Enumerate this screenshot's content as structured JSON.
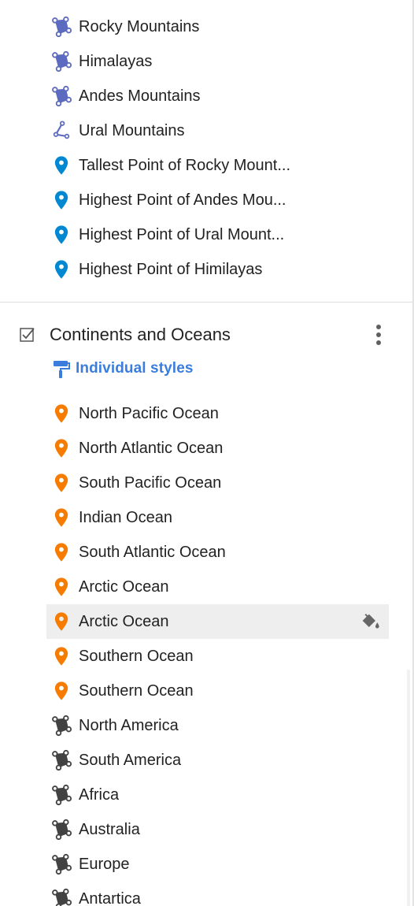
{
  "top_items": [
    {
      "label": "Rocky Mountains",
      "icon": "polygon-icon",
      "color": "#5c6bc0"
    },
    {
      "label": "Himalayas",
      "icon": "polygon-icon",
      "color": "#5c6bc0"
    },
    {
      "label": "Andes Mountains",
      "icon": "polygon-icon",
      "color": "#5c6bc0"
    },
    {
      "label": "Ural Mountains",
      "icon": "line-icon",
      "color": "#5c6bc0"
    },
    {
      "label": "Tallest Point of Rocky Mount...",
      "icon": "pin-icon",
      "color": "#0288d1"
    },
    {
      "label": "Highest Point of Andes Mou...",
      "icon": "pin-icon",
      "color": "#0288d1"
    },
    {
      "label": "Highest Point of Ural Mount...",
      "icon": "pin-icon",
      "color": "#0288d1"
    },
    {
      "label": "Highest Point of Himilayas",
      "icon": "pin-icon",
      "color": "#0288d1"
    }
  ],
  "layer": {
    "title": "Continents and Oceans",
    "checked": true,
    "styles_label": "Individual styles",
    "styles_color": "#3b7ddd"
  },
  "layer_items": [
    {
      "label": "North Pacific Ocean",
      "icon": "pin-icon",
      "color": "#f57c00"
    },
    {
      "label": "North Atlantic Ocean",
      "icon": "pin-icon",
      "color": "#f57c00"
    },
    {
      "label": "South Pacific Ocean",
      "icon": "pin-icon",
      "color": "#f57c00"
    },
    {
      "label": "Indian Ocean",
      "icon": "pin-icon",
      "color": "#f57c00"
    },
    {
      "label": "South Atlantic Ocean",
      "icon": "pin-icon",
      "color": "#f57c00"
    },
    {
      "label": "Arctic Ocean",
      "icon": "pin-icon",
      "color": "#f57c00"
    },
    {
      "label": "Arctic Ocean",
      "icon": "pin-icon",
      "color": "#f57c00",
      "highlighted": true
    },
    {
      "label": "Southern Ocean",
      "icon": "pin-icon",
      "color": "#f57c00"
    },
    {
      "label": "Southern Ocean",
      "icon": "pin-icon",
      "color": "#f57c00"
    },
    {
      "label": "North America",
      "icon": "polygon-icon",
      "color": "#424242"
    },
    {
      "label": "South America",
      "icon": "polygon-icon",
      "color": "#424242"
    },
    {
      "label": "Africa",
      "icon": "polygon-icon",
      "color": "#424242"
    },
    {
      "label": "Australia",
      "icon": "polygon-icon",
      "color": "#424242"
    },
    {
      "label": "Europe",
      "icon": "polygon-icon",
      "color": "#424242"
    },
    {
      "label": "Antartica",
      "icon": "polygon-icon",
      "color": "#424242"
    }
  ]
}
